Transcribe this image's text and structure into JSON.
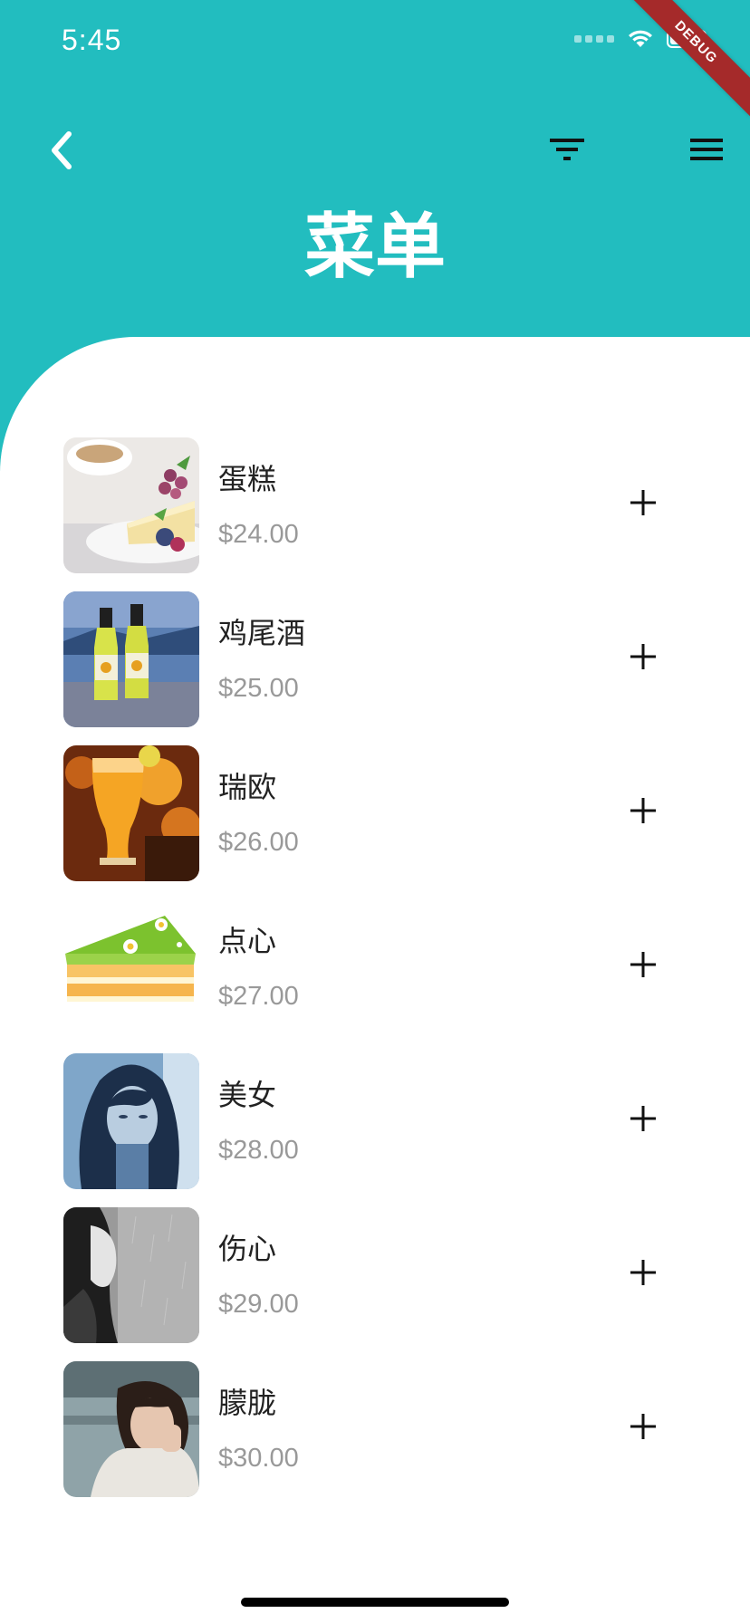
{
  "status_bar": {
    "time": "5:45",
    "debug_label": "DEBUG"
  },
  "header": {
    "title": "菜单",
    "back_icon": "chevron-left-icon",
    "filter_icon": "filter-icon",
    "menu_icon": "hamburger-menu-icon"
  },
  "colors": {
    "primary": "#22BDBF",
    "text_primary": "#222222",
    "text_secondary": "#999999",
    "ribbon": "#A52A2A"
  },
  "items": [
    {
      "name": "蛋糕",
      "price": "$24.00",
      "image": "cheesecake-photo"
    },
    {
      "name": "鸡尾酒",
      "price": "$25.00",
      "image": "cocktail-bottles-photo"
    },
    {
      "name": "瑞欧",
      "price": "$26.00",
      "image": "orange-drink-photo"
    },
    {
      "name": "点心",
      "price": "$27.00",
      "image": "cake-slice-illustration"
    },
    {
      "name": "美女",
      "price": "$28.00",
      "image": "woman-portrait-blue-photo"
    },
    {
      "name": "伤心",
      "price": "$29.00",
      "image": "woman-rain-grayscale-photo"
    },
    {
      "name": "朦胧",
      "price": "$30.00",
      "image": "woman-portrait-photo"
    }
  ],
  "add_icon": "plus-icon"
}
